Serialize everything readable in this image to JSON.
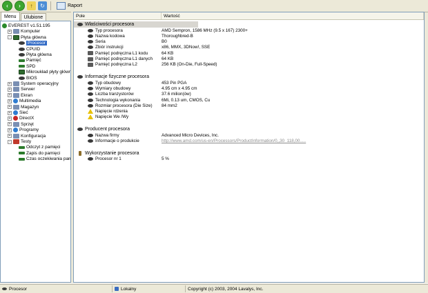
{
  "toolbar": {
    "report_label": "Raport"
  },
  "tabs": {
    "menu": "Menu",
    "favorites": "Ulubione"
  },
  "tree": [
    {
      "label": "EVEREST v1.51.195",
      "indent": 0,
      "icon": "info",
      "expander": ""
    },
    {
      "label": "Komputer",
      "indent": 1,
      "icon": "folder",
      "expander": "+"
    },
    {
      "label": "Płyta główna",
      "indent": 1,
      "icon": "board",
      "expander": "-"
    },
    {
      "label": "Procesor",
      "indent": 2,
      "icon": "cpu",
      "expander": "",
      "selected": true
    },
    {
      "label": "CPUID",
      "indent": 2,
      "icon": "cpu",
      "expander": ""
    },
    {
      "label": "Płyta główna",
      "indent": 2,
      "icon": "cpu",
      "expander": ""
    },
    {
      "label": "Pamięć",
      "indent": 2,
      "icon": "mem",
      "expander": ""
    },
    {
      "label": "SPD",
      "indent": 2,
      "icon": "mem",
      "expander": ""
    },
    {
      "label": "Mikroukład płyty głównej",
      "indent": 2,
      "icon": "board",
      "expander": ""
    },
    {
      "label": "BIOS",
      "indent": 2,
      "icon": "cpu",
      "expander": ""
    },
    {
      "label": "System operacyjny",
      "indent": 1,
      "icon": "folder",
      "expander": "+"
    },
    {
      "label": "Serwer",
      "indent": 1,
      "icon": "folder",
      "expander": "+"
    },
    {
      "label": "Ekran",
      "indent": 1,
      "icon": "folder",
      "expander": "+"
    },
    {
      "label": "Multimedia",
      "indent": 1,
      "icon": "globe",
      "expander": "+"
    },
    {
      "label": "Magazyn",
      "indent": 1,
      "icon": "folder",
      "expander": "+"
    },
    {
      "label": "Sieć",
      "indent": 1,
      "icon": "globe",
      "expander": "+"
    },
    {
      "label": "DirectX",
      "indent": 1,
      "icon": "red",
      "expander": "+"
    },
    {
      "label": "Sprzęt",
      "indent": 1,
      "icon": "folder",
      "expander": "+"
    },
    {
      "label": "Programy",
      "indent": 1,
      "icon": "globe",
      "expander": "+"
    },
    {
      "label": "Konfiguracja",
      "indent": 1,
      "icon": "folder",
      "expander": "+"
    },
    {
      "label": "Testy",
      "indent": 1,
      "icon": "test",
      "expander": "-"
    },
    {
      "label": "Odczyt z pamięci",
      "indent": 2,
      "icon": "mem",
      "expander": ""
    },
    {
      "label": "Zapis do pamięci",
      "indent": 2,
      "icon": "mem",
      "expander": ""
    },
    {
      "label": "Czas oczekiwania pamięci",
      "indent": 2,
      "icon": "mem",
      "expander": ""
    }
  ],
  "columns": {
    "field": "Pole",
    "value": "Wartość"
  },
  "sections": [
    {
      "title": "Właściwości procesora",
      "icon": "cpu",
      "highlighted": true,
      "rows": [
        {
          "field": "Typ procesora",
          "value": "AMD Sempron, 1586 MHz (9.5 x 167) 2300+",
          "icon": "cpu"
        },
        {
          "field": "Nazwa kodowa",
          "value": "Thoroughbred-B",
          "icon": "cpu"
        },
        {
          "field": "Seria",
          "value": "B0",
          "icon": "cpu"
        },
        {
          "field": "Zbiór instrukcji",
          "value": "x86, MMX, 3DNow!, SSE",
          "icon": "cpu"
        },
        {
          "field": "Pamięć podręczna L1 kodu",
          "value": "64 KB",
          "icon": "board"
        },
        {
          "field": "Pamięć podręczna L1 danych",
          "value": "64 KB",
          "icon": "board"
        },
        {
          "field": "Pamięć podręczna L2",
          "value": "256 KB  (On-Die, Full-Speed)",
          "icon": "board"
        }
      ]
    },
    {
      "title": "Informacje fizyczne procesora",
      "icon": "cpu",
      "highlighted": false,
      "rows": [
        {
          "field": "Typ obudowy",
          "value": "453 Pin PGA",
          "icon": "cpu"
        },
        {
          "field": "Wymiary obudowy",
          "value": "4.95 cm x 4.95 cm",
          "icon": "cpu"
        },
        {
          "field": "Liczba tranzystorów",
          "value": "37.6 milion(ów)",
          "icon": "cpu"
        },
        {
          "field": "Technologia wykonania",
          "value": "6Mi, 0.13 um, CMOS, Cu",
          "icon": "cpu"
        },
        {
          "field": "Rozmiar procesora (Die Size)",
          "value": "84 mm2",
          "icon": "cpu"
        },
        {
          "field": "Napięcie rdzenia",
          "value": "",
          "icon": "warn"
        },
        {
          "field": "Napięcie We /Wy",
          "value": "",
          "icon": "warn"
        }
      ]
    },
    {
      "title": "Producent procesora",
      "icon": "cpu",
      "highlighted": false,
      "rows": [
        {
          "field": "Nazwa firmy",
          "value": "Advanced Micro Devices, Inc.",
          "icon": "cpu"
        },
        {
          "field": "Informacje o produkcie",
          "value": "http://www.amd.com/us-en/Processors/ProductInformation/0,,30_118,00.....",
          "icon": "cpu",
          "link": true
        }
      ]
    },
    {
      "title": "Wykorzystanie procesora",
      "icon": "hourglass",
      "highlighted": false,
      "rows": [
        {
          "field": "Procesor nr 1",
          "value": "5 %",
          "icon": "cpu"
        }
      ]
    }
  ],
  "status": {
    "left": "Procesor",
    "middle": "Lokalny",
    "right": "Copyright (c) 2003, 2004 Lavalys, Inc."
  }
}
